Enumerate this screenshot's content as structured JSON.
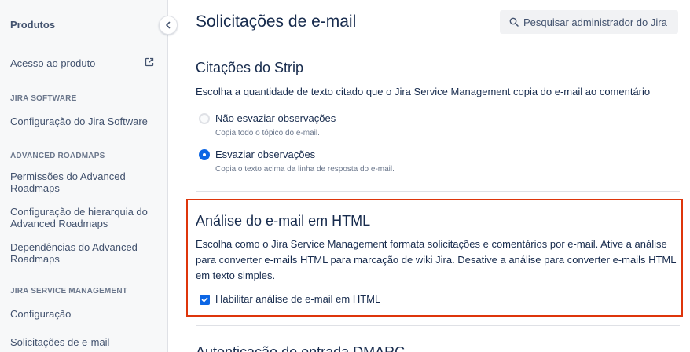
{
  "sidebar": {
    "title": "Produtos",
    "items": {
      "product_access": "Acesso ao produto",
      "jira_software_config": "Configuração do Jira Software",
      "advanced_roadmaps_perms": "Permissões do Advanced Roadmaps",
      "hierarchy_config": "Configuração de hierarquia do Advanced Roadmaps",
      "advanced_roadmaps_deps": "Dependências do Advanced Roadmaps",
      "jsm_config": "Configuração",
      "email_requests": "Solicitações de e-mail"
    },
    "sections": {
      "jira_software": "JIRA SOFTWARE",
      "advanced_roadmaps": "ADVANCED ROADMAPS",
      "jsm": "JIRA SERVICE MANAGEMENT"
    }
  },
  "page": {
    "title": "Solicitações de e-mail",
    "search_label": "Pesquisar administrador do Jira"
  },
  "strip": {
    "heading": "Citações do Strip",
    "description": "Escolha a quantidade de texto citado que o Jira Service Management copia do e-mail ao comentário",
    "options": [
      {
        "label": "Não esvaziar observações",
        "help": "Copia todo o tópico do e-mail.",
        "checked": false
      },
      {
        "label": "Esvaziar observações",
        "help": "Copia o texto acima da linha de resposta do e-mail.",
        "checked": true
      }
    ]
  },
  "html_parsing": {
    "heading": "Análise do e-mail em HTML",
    "description_lines": [
      "Escolha como o Jira Service Management formata solicitações e comentários por e-mail. Ative a análise",
      "para converter e-mails HTML para marcação de wiki Jira. Desative a análise para converter e-mails HTML",
      "em texto simples."
    ],
    "checkbox_label": "Habilitar análise de e-mail em HTML",
    "checkbox_checked": true
  },
  "next_section": {
    "heading_partial": "Autenticação de entrada DMARC"
  },
  "colors": {
    "accent": "#0c66e4",
    "highlight_border": "#de350b"
  }
}
